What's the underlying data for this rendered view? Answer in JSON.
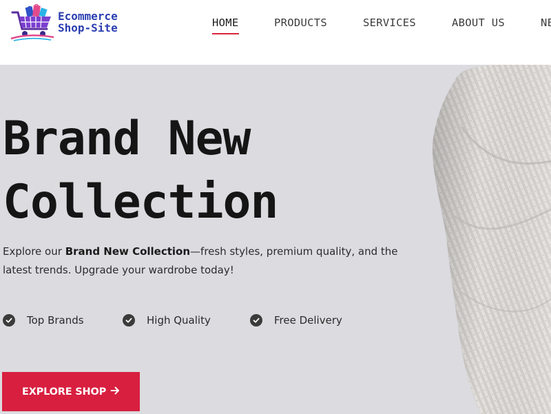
{
  "header": {
    "logo": {
      "line1": "Ecommerce",
      "line2": "Shop-Site"
    },
    "nav": [
      {
        "label": "HOME",
        "active": true
      },
      {
        "label": "PRODUCTS",
        "active": false
      },
      {
        "label": "SERVICES",
        "active": false
      },
      {
        "label": "ABOUT US",
        "active": false
      },
      {
        "label": "NE",
        "active": false
      }
    ]
  },
  "hero": {
    "title_line1": "Brand New",
    "title_line2": "Collection",
    "desc_prefix": "Explore our ",
    "desc_bold": "Brand New Collection",
    "desc_suffix": "—fresh styles, premium quality, and the latest trends. Upgrade your wardrobe today!",
    "features": [
      "Top Brands",
      "High Quality",
      "Free Delivery"
    ],
    "cta_label": "EXPLORE SHOP",
    "cta_icon": "arrow-right-icon",
    "image": "knit-sweater-image"
  },
  "colors": {
    "accent": "#d81f3f",
    "logo_blue": "#2b3fb0",
    "hero_bg": "#dcdbe0",
    "check_bg": "#3b3b3b"
  }
}
